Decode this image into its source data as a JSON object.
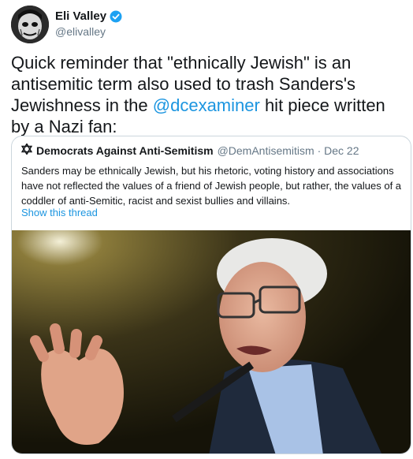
{
  "author": {
    "name": "Eli Valley",
    "handle": "@elivalley",
    "verified_icon": "verified-badge-icon"
  },
  "tweet": {
    "text_before": "Quick reminder that \"ethnically Jewish\" is an antisemitic term also used to trash Sanders's Jewishness in the ",
    "mention": "@dcexaminer",
    "text_after": " hit piece written by a Nazi fan:"
  },
  "quoted": {
    "icon": "star-of-david-icon",
    "name": "Democrats Against Anti-Semitism",
    "meta": "@DemAntisemitism · Dec 22",
    "text": "Sanders may be ethnically Jewish, but his rhetoric, voting history and associations have not reflected the values of a friend of Jewish people, but rather, the values of a coddler of anti-Semitic, racist and sexist bullies and villains.",
    "show_thread": "Show this thread"
  },
  "colors": {
    "link": "#1b95e0",
    "muted": "#657786",
    "border": "#ccd6dd"
  }
}
